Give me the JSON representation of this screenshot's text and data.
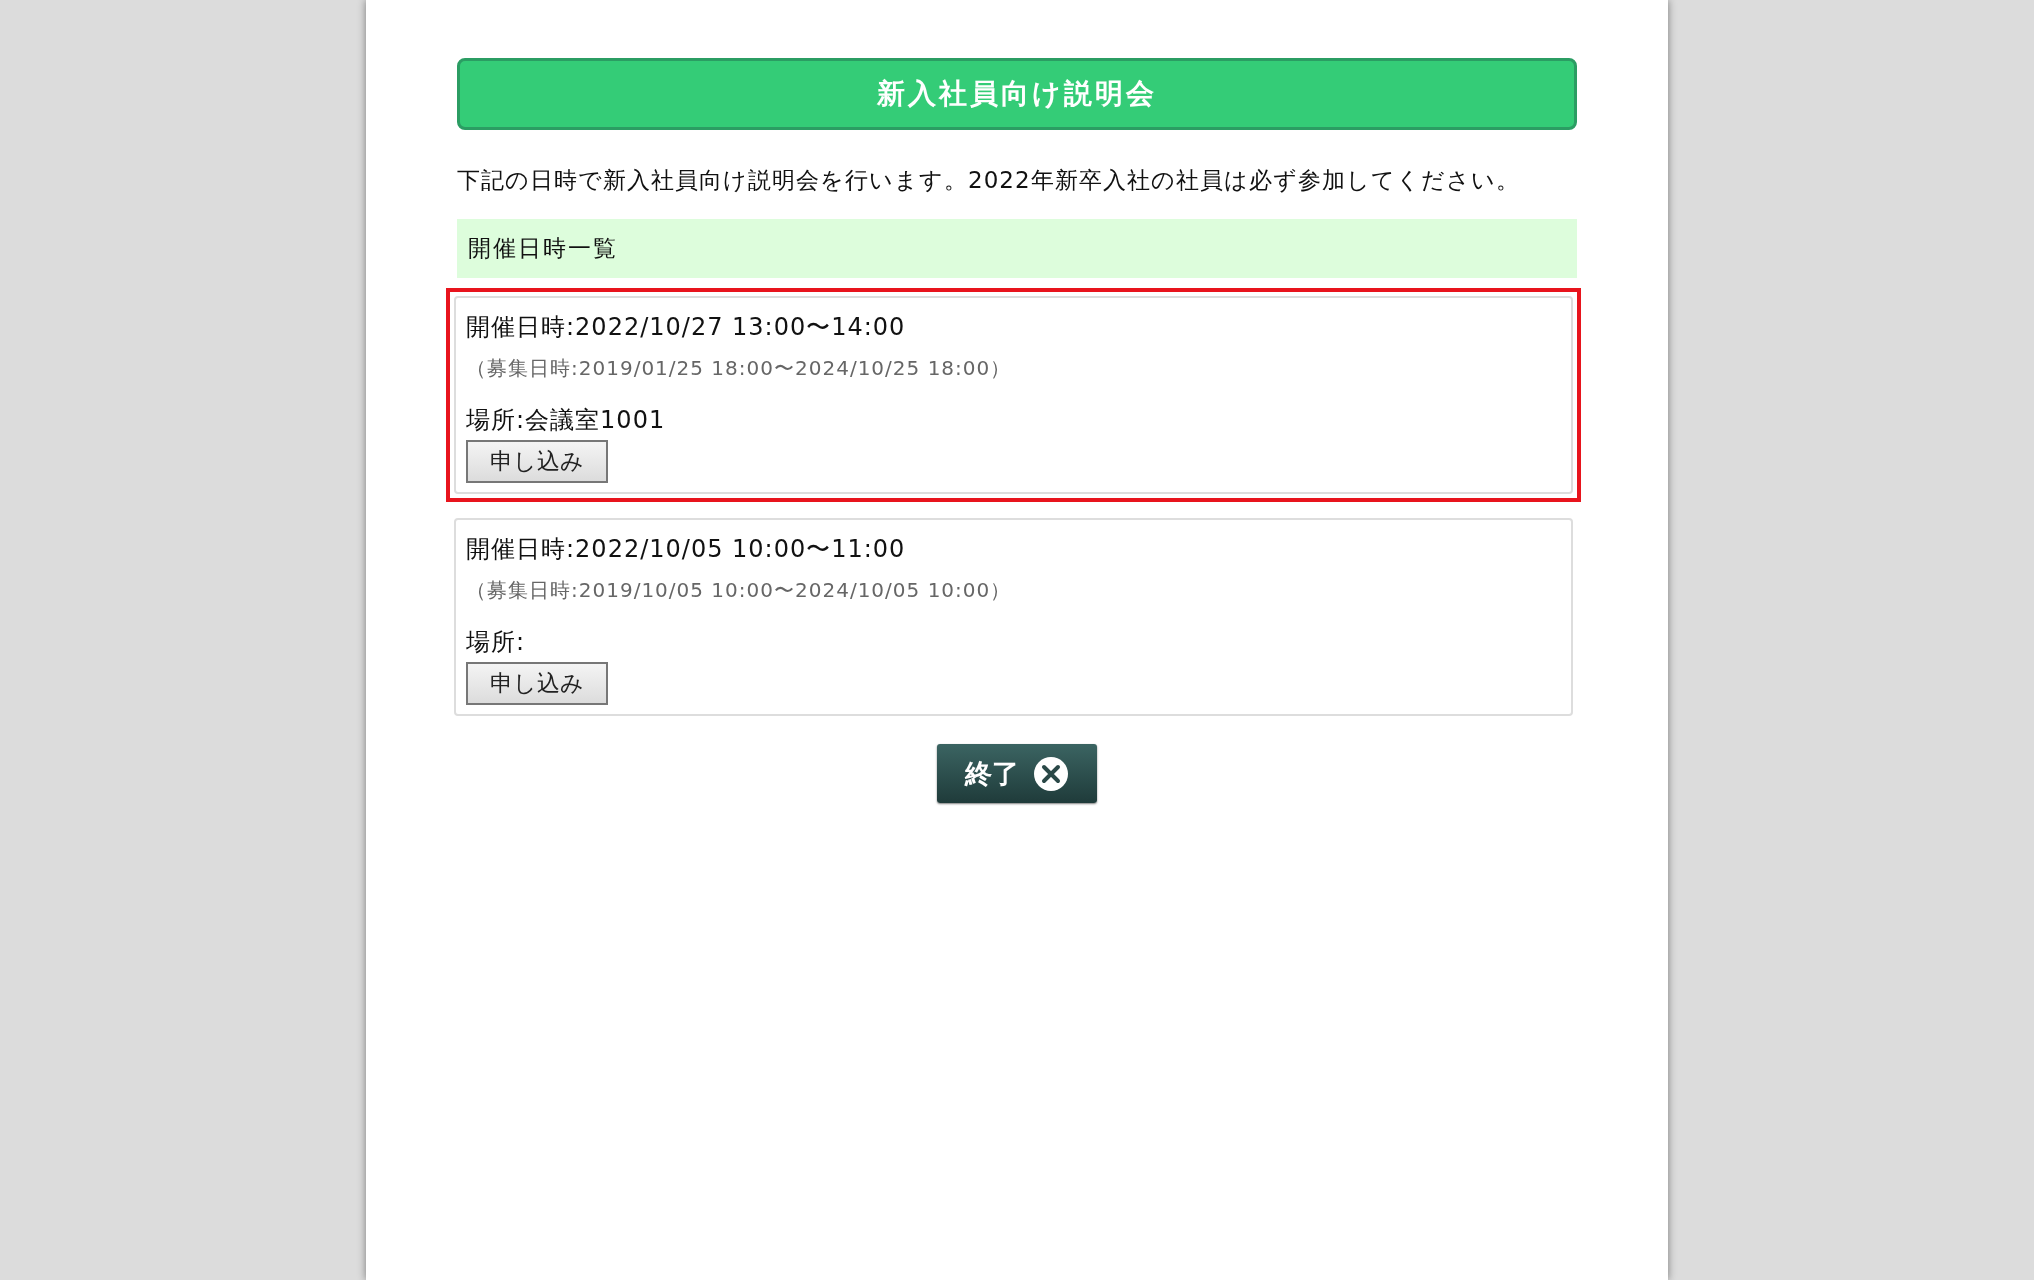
{
  "header": {
    "title": "新入社員向け説明会"
  },
  "description": "下記の日時で新入社員向け説明会を行います。2022年新卒入社の社員は必ず参加してください。",
  "list_heading": "開催日時一覧",
  "events": [
    {
      "datetime": "開催日時:2022/10/27 13:00〜14:00",
      "recruitment": "（募集日時:2019/01/25 18:00〜2024/10/25 18:00）",
      "place": "場所:会議室1001",
      "button": "申し込み",
      "highlighted": true
    },
    {
      "datetime": "開催日時:2022/10/05 10:00〜11:00",
      "recruitment": "（募集日時:2019/10/05 10:00〜2024/10/05 10:00）",
      "place": "場所:",
      "button": "申し込み",
      "highlighted": false
    }
  ],
  "close_button": {
    "label": "終了"
  }
}
